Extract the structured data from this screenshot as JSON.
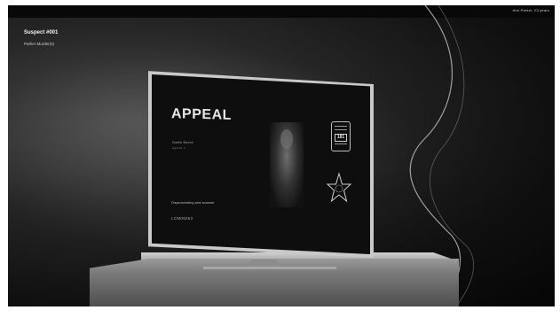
{
  "header": {
    "right_text": "Ann Parker, 23 years"
  },
  "suspect": {
    "title": "Suspect #001",
    "subtitle": "Parker Murder(s)"
  },
  "tv_screen": {
    "heading": "APPEAL",
    "victim_name": "Noelle Beech",
    "victim_detail": "Aged 32, 3",
    "missing_label": "Disproceeding and scanner",
    "reference": "LCM09263",
    "id_card_number": "181"
  },
  "icons": [
    "photo",
    "id-card-icon",
    "sheriff-star-badge-icon"
  ]
}
